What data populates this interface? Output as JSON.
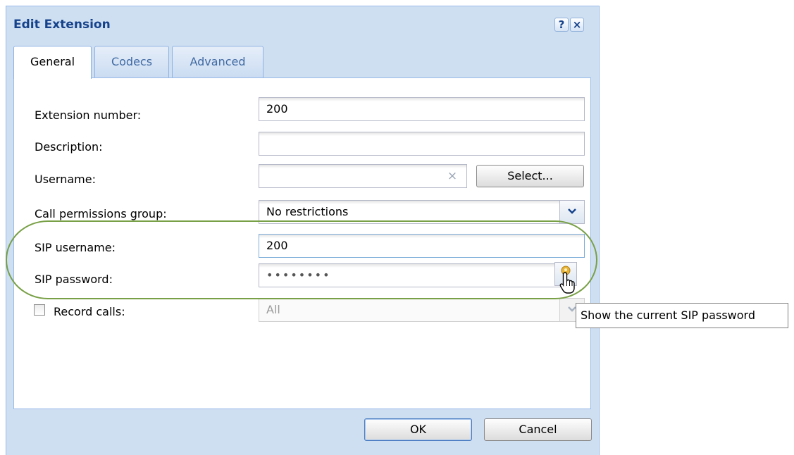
{
  "dialog": {
    "title": "Edit Extension",
    "help_icon": "?",
    "close_icon": "×"
  },
  "tabs": [
    {
      "label": "General",
      "active": true
    },
    {
      "label": "Codecs",
      "active": false
    },
    {
      "label": "Advanced",
      "active": false
    }
  ],
  "form": {
    "extension_number": {
      "label": "Extension number:",
      "value": "200"
    },
    "description": {
      "label": "Description:",
      "value": ""
    },
    "username": {
      "label": "Username:",
      "value": "",
      "clear_icon": "×",
      "select_button": "Select..."
    },
    "call_permissions_group": {
      "label": "Call permissions group:",
      "value": "No restrictions",
      "icon": "chevron-down-icon"
    },
    "sip_username": {
      "label": "SIP username:",
      "value": "200"
    },
    "sip_password": {
      "label": "SIP password:",
      "value": "••••••••",
      "icon": "key-icon"
    },
    "record_calls": {
      "label": "Record calls:",
      "checked": false,
      "value": "All"
    }
  },
  "tooltip": "Show the current SIP password",
  "buttons": {
    "ok": "OK",
    "cancel": "Cancel"
  },
  "colors": {
    "title": "#15428b",
    "window_bg": "#cfdff2",
    "highlight_ring": "#78a046"
  }
}
